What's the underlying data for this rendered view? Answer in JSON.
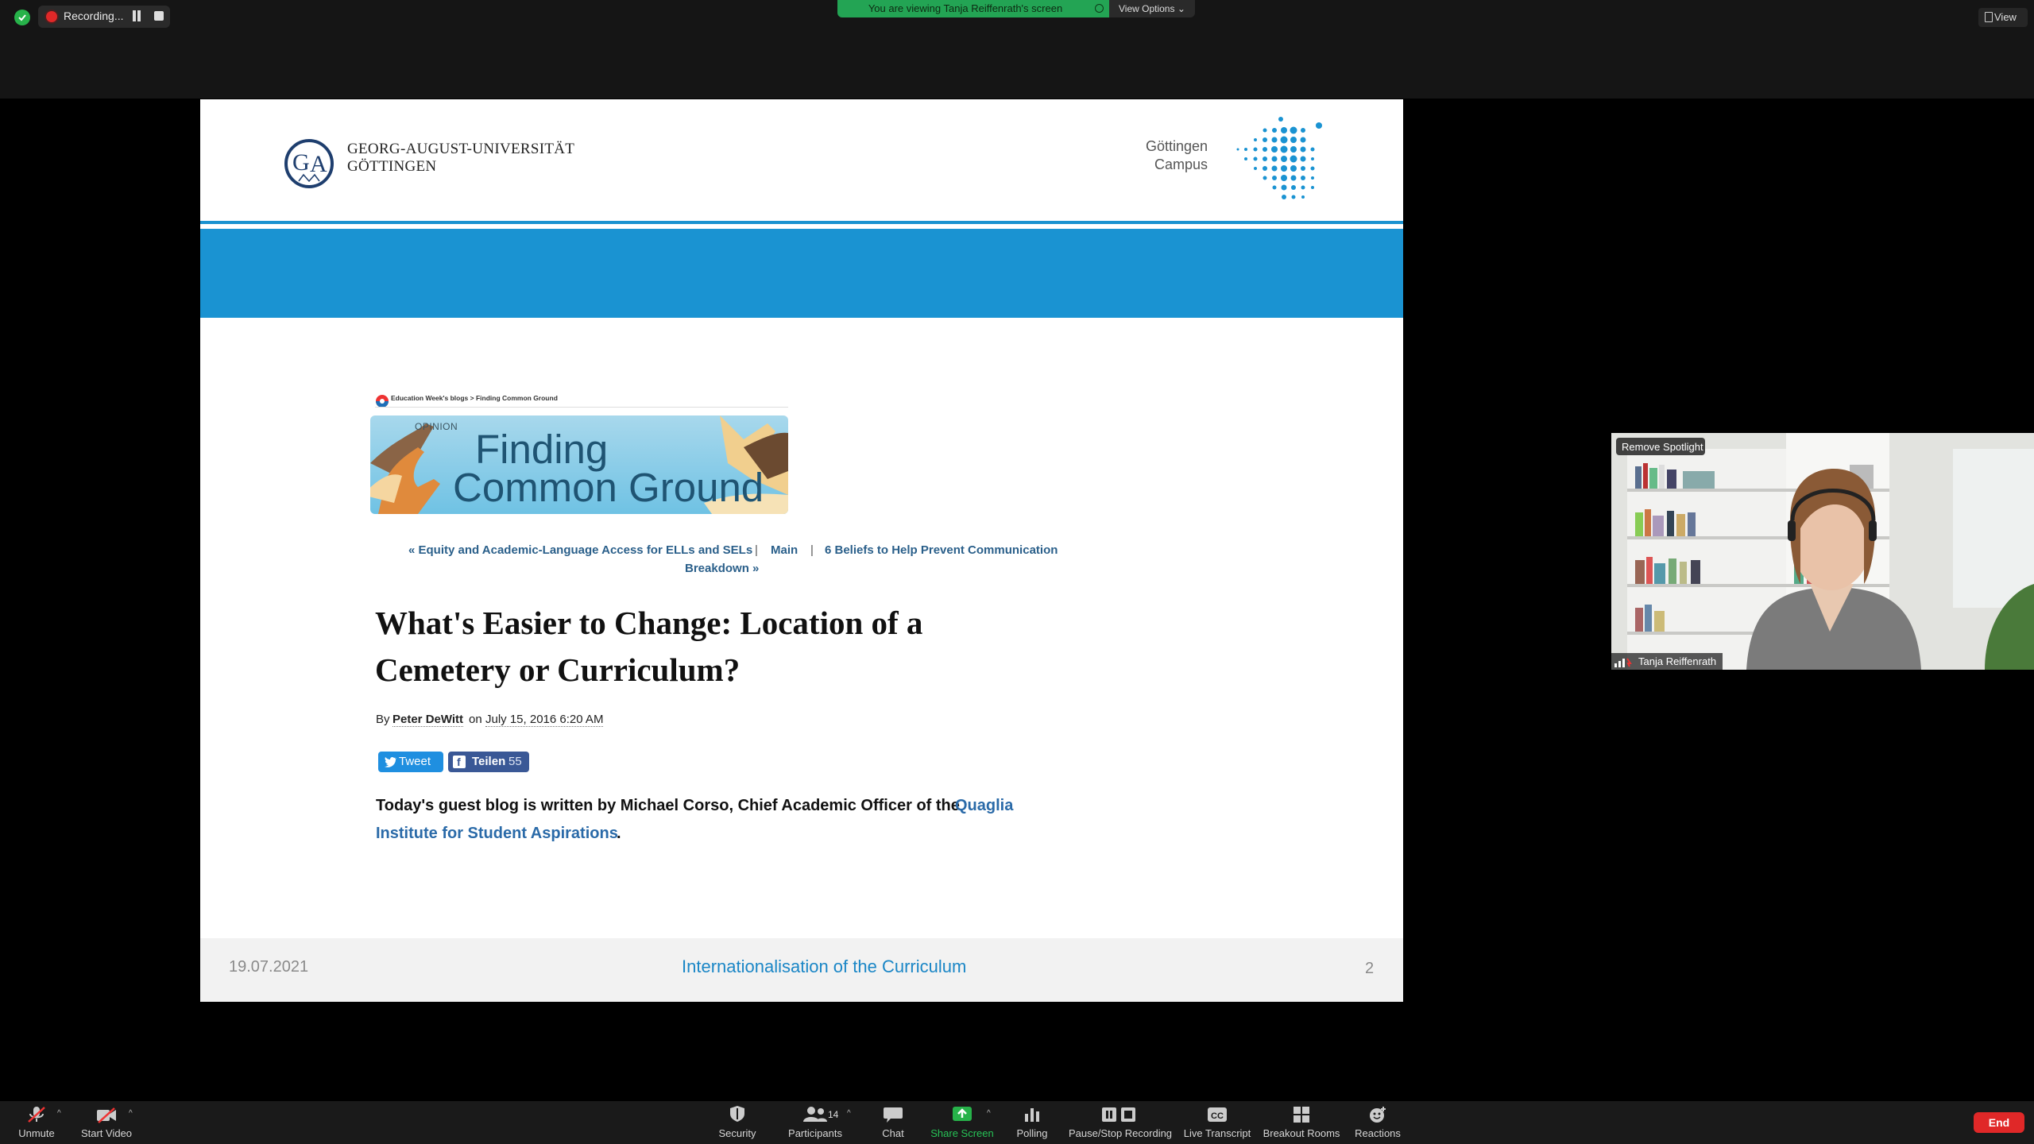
{
  "recording": {
    "label": "Recording..."
  },
  "share_banner": {
    "text": "You are viewing Tanja Reiffenrath's screen",
    "view_options": "View Options"
  },
  "view_button": {
    "label": "View"
  },
  "slide": {
    "university": {
      "line1": "GEORG-AUGUST-UNIVERSITÄT",
      "line2": "GÖTTINGEN"
    },
    "campus": {
      "line1": "Göttingen",
      "line2": "Campus"
    },
    "article": {
      "breadcrumb": "Education Week's blogs > Finding Common Ground",
      "banner": {
        "tag": "OPINION",
        "title_line1": "Finding",
        "title_line2": "Common Ground"
      },
      "nav": {
        "prev": "« Equity and Academic-Language Access for ELLs and SELs",
        "sep": "|",
        "main": "Main",
        "next_line1": "6 Beliefs to Help Prevent Communication",
        "next_line2": "Breakdown »"
      },
      "headline_line1": "What's Easier to Change: Location of a",
      "headline_line2": "Cemetery or Curriculum?",
      "byline": {
        "by": "By",
        "author": "Peter DeWitt",
        "on": "on",
        "date": "July 15, 2016 6:20 AM"
      },
      "social": {
        "tweet": "Tweet",
        "share": "Teilen",
        "share_count": "55"
      },
      "intro": {
        "text": "Today's guest blog is written by Michael Corso, Chief Academic Officer of the",
        "link_line1": "Quaglia",
        "link_line2": "Institute for Student Aspirations",
        "end": "."
      }
    },
    "footer": {
      "date": "19.07.2021",
      "title": "Internationalisation of the Curriculum",
      "page": "2"
    }
  },
  "spotlight": {
    "remove_label": "Remove Spotlight",
    "participant_name": "Tanja Reiffenrath"
  },
  "toolbar": {
    "unmute": "Unmute",
    "start_video": "Start Video",
    "security": "Security",
    "participants": "Participants",
    "participants_count": "14",
    "chat": "Chat",
    "share_screen": "Share Screen",
    "polling": "Polling",
    "pause_stop_recording": "Pause/Stop Recording",
    "live_transcript": "Live Transcript",
    "breakout_rooms": "Breakout Rooms",
    "reactions": "Reactions",
    "end": "End"
  },
  "colors": {
    "slide_blue": "#1a93d2",
    "share_green": "#23a454",
    "end_red": "#e02828"
  }
}
